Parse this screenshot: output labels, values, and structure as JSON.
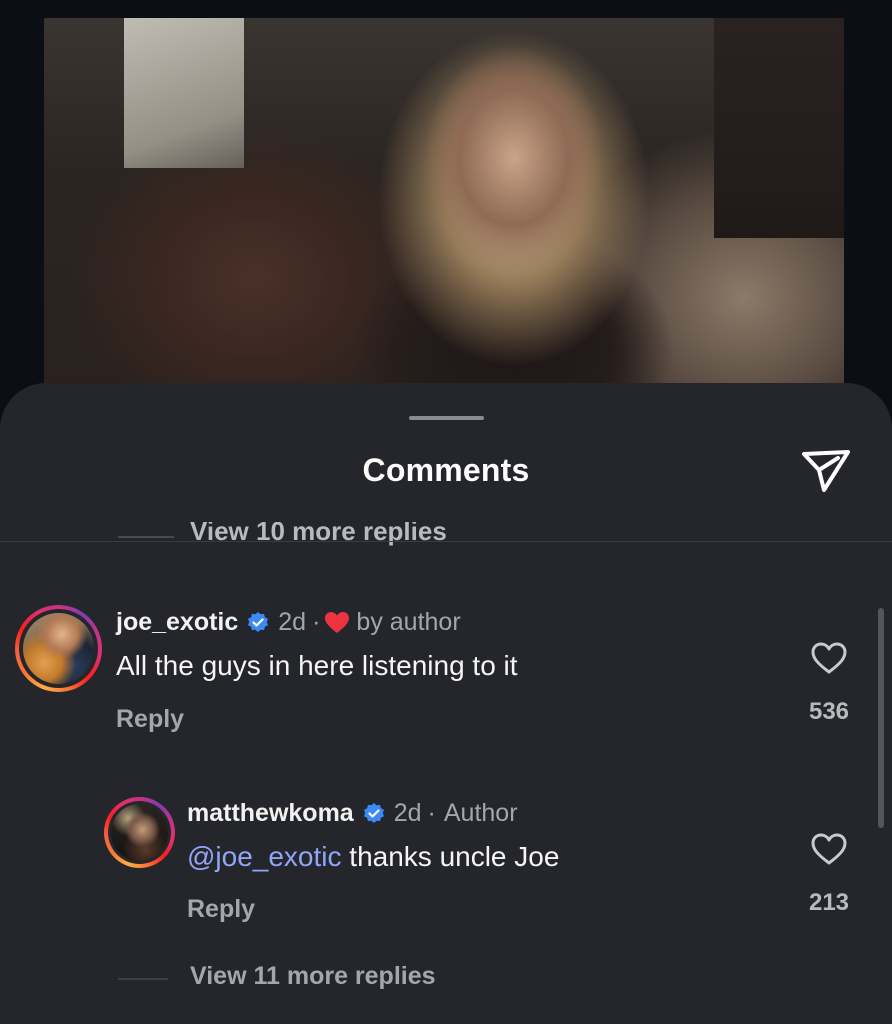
{
  "header": {
    "title": "Comments",
    "send_icon": "paper-plane-icon"
  },
  "partial_link": "View 10 more replies",
  "comments": [
    {
      "username": "joe_exotic",
      "verified": true,
      "time": "2d",
      "separator": "·",
      "liked_by": "by author",
      "text": "All the guys in here listening to it",
      "reply_label": "Reply",
      "likes": "536"
    },
    {
      "username": "matthewkoma",
      "verified": true,
      "time": "2d",
      "separator": "·",
      "author_label": "Author",
      "mention": "@joe_exotic",
      "text": " thanks uncle Joe",
      "reply_label": "Reply",
      "likes": "213"
    }
  ],
  "view_more_replies": "View 11 more replies",
  "colors": {
    "sheet_bg": "#25262b",
    "mention": "#8fa6f8",
    "verified": "#3d8af7",
    "heart_red": "#ed3342"
  }
}
